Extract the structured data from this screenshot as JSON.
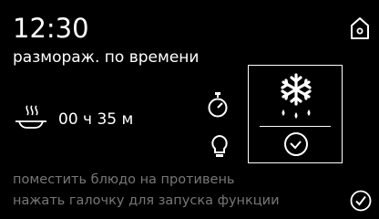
{
  "status": {
    "clock": "12:30"
  },
  "program": {
    "mode": "размораж. по времени",
    "duration": "00 ч 35 м"
  },
  "hints": [
    "поместить блюдо на противень",
    "нажать галочку для запуска функции"
  ],
  "icons": {
    "home": "home-icon",
    "dish": "dish-steam-icon",
    "timer": "stopwatch-icon",
    "probe": "probe-icon",
    "defrost": "snowflake-drops-icon",
    "clock": "clock-icon",
    "confirm": "checkmark-icon"
  },
  "colors": {
    "background": "#000000",
    "text": "#ffffff",
    "hint": "#777777"
  }
}
